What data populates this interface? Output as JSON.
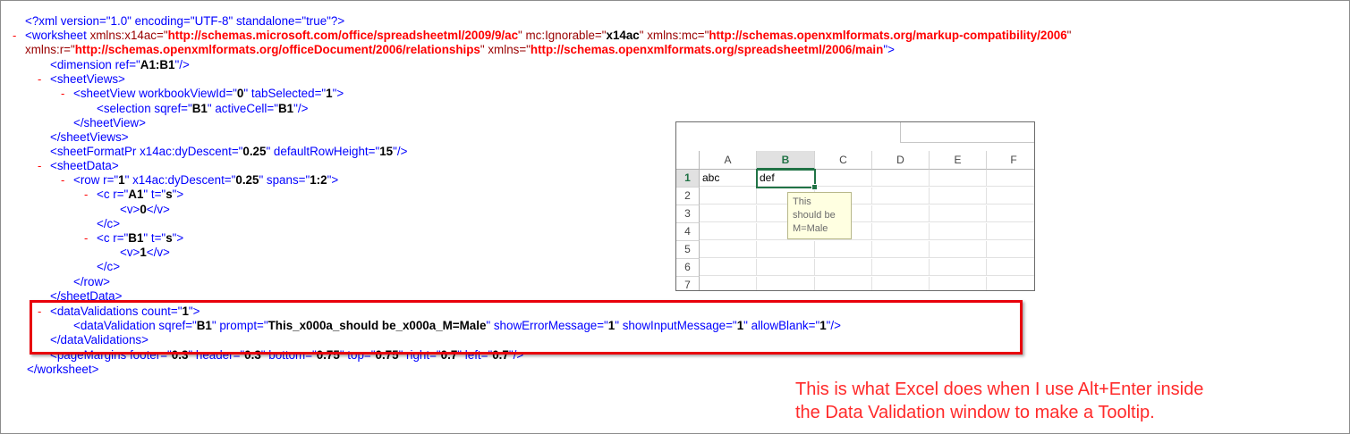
{
  "xml": {
    "declaration": "<?xml version=\"1.0\" encoding=\"UTF-8\" standalone=\"true\"?>",
    "collapse_marker": "-",
    "worksheet": {
      "open": "<worksheet",
      "attr1_name": " xmlns:x14ac=\"",
      "attr1_value": "http://schemas.microsoft.com/office/spreadsheetml/2009/9/ac",
      "attr2_name": "\" mc:Ignorable=\"",
      "attr2_value": "x14ac",
      "attr3_name": "\" xmlns:mc=\"",
      "attr3_value": "http://schemas.openxmlformats.org/markup-compatibility/2006",
      "attr3_close": "\"",
      "line2_attr_name": "xmlns:r=\"",
      "line2_attr_value": "http://schemas.openxmlformats.org/officeDocument/2006/relationships",
      "line2_attr2_name": "\" xmlns=\"",
      "line2_attr2_value": "http://schemas.openxmlformats.org/spreadsheetml/2006/main",
      "line2_close": "\">",
      "close": "</worksheet>"
    },
    "dimension": {
      "pre": "<dimension ref=\"",
      "val": "A1:B1",
      "post": "\"/>"
    },
    "sheetViews_open": "<sheetViews>",
    "sheetView": {
      "pre": "<sheetView workbookViewId=\"",
      "val1": "0",
      "mid": "\" tabSelected=\"",
      "val2": "1",
      "post": "\">"
    },
    "selection": {
      "pre": "<selection sqref=\"",
      "val1": "B1",
      "mid": "\" activeCell=\"",
      "val2": "B1",
      "post": "\"/>"
    },
    "sheetView_close": "</sheetView>",
    "sheetViews_close": "</sheetViews>",
    "sheetFormatPr": {
      "pre": "<sheetFormatPr x14ac:dyDescent=\"",
      "val1": "0.25",
      "mid": "\" defaultRowHeight=\"",
      "val2": "15",
      "post": "\"/>"
    },
    "sheetData_open": "<sheetData>",
    "row": {
      "pre": "<row r=\"",
      "val1": "1",
      "mid1": "\" x14ac:dyDescent=\"",
      "val2": "0.25",
      "mid2": "\" spans=\"",
      "val3": "1:2",
      "post": "\">"
    },
    "c1": {
      "pre": "<c r=\"",
      "val1": "A1",
      "mid": "\" t=\"",
      "val2": "s",
      "post": "\">"
    },
    "v1": {
      "pre": "<v>",
      "val": "0",
      "post": "</v>"
    },
    "c_close": "</c>",
    "c2": {
      "pre": "<c r=\"",
      "val1": "B1",
      "mid": "\" t=\"",
      "val2": "s",
      "post": "\">"
    },
    "v2": {
      "pre": "<v>",
      "val": "1",
      "post": "</v>"
    },
    "row_close": "</row>",
    "sheetData_close": "</sheetData>",
    "dataValidations": {
      "pre": "<dataValidations count=\"",
      "val": "1",
      "post": "\">"
    },
    "dataValidation": {
      "pre": "<dataValidation sqref=\"",
      "sqref": "B1",
      "m1": "\" prompt=\"",
      "prompt": "This_x000a_should be_x000a_M=Male",
      "m2": "\" showErrorMessage=\"",
      "showError": "1",
      "m3": "\" showInputMessage=\"",
      "showInput": "1",
      "m4": "\" allowBlank=\"",
      "allowBlank": "1",
      "post": "\"/>"
    },
    "dataValidations_close": "</dataValidations>",
    "pageMargins": {
      "pre": "<pageMargins footer=\"",
      "footer": "0.3",
      "m1": "\" header=\"",
      "header": "0.3",
      "m2": "\" bottom=\"",
      "bottom": "0.75",
      "m3": "\" top=\"",
      "top": "0.75",
      "m4": "\" right=\"",
      "right": "0.7",
      "m5": "\" left=\"",
      "left": "0.7",
      "post": "\"/>"
    }
  },
  "excel": {
    "columns": [
      "A",
      "B",
      "C",
      "D",
      "E",
      "F"
    ],
    "selected_column": "B",
    "rows": [
      "1",
      "2",
      "3",
      "4",
      "5",
      "6",
      "7"
    ],
    "cells": {
      "A1": "abc",
      "B1": "def"
    },
    "tooltip": "This\nshould be\nM=Male"
  },
  "annotation": {
    "line1": "This is what Excel does when I use Alt+Enter inside",
    "line2": "the Data Validation window to make a Tooltip."
  },
  "colors": {
    "tag": "#0000ff",
    "attr": "#990000",
    "value_url": "#ff0000",
    "highlight": "#e8000b",
    "excel_green": "#217346",
    "note": "#ff2a2a"
  }
}
